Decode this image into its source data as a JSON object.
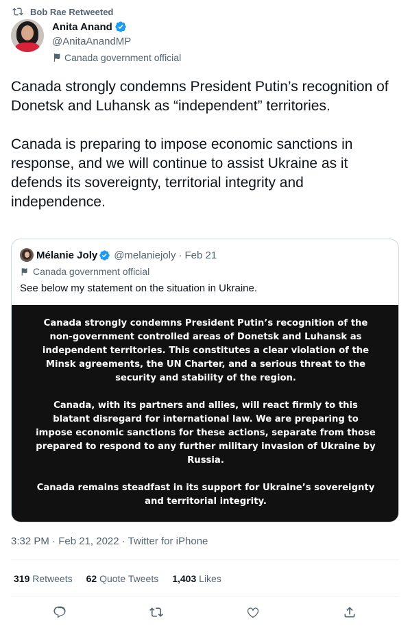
{
  "retweet": {
    "label": "Bob Rae Retweeted",
    "icon": "retweet-icon"
  },
  "author": {
    "name": "Anita Anand",
    "handle": "@AnitaAnandMP",
    "label": "Canada government official"
  },
  "tweet": {
    "text": "Canada strongly condemns President Putin’s recognition of Donetsk and Luhansk as “independent” territories.\n\nCanada is preparing to impose economic sanctions in response, and we will continue to assist Ukraine as it defends its sovereignty, territorial integrity and independence."
  },
  "quote": {
    "name": "Mélanie Joly",
    "handle": "@melaniejoly",
    "separator": "·",
    "date": "Feb 21",
    "label": "Canada government official",
    "text": "See below my statement on the situation in Ukraine.",
    "statement": {
      "p1": "Canada strongly condemns President Putin’s recognition of the non-government controlled areas of Donetsk and Luhansk as independent territories. This constitutes a clear violation of the Minsk agreements, the UN Charter, and a serious threat to the security and stability of the region.",
      "p2": "Canada, with its partners and allies, will react firmly to this blatant disregard for international law. We are preparing to impose economic sanctions for these actions, separate from those prepared to respond to any further military invasion of Ukraine by Russia.",
      "p3": "Canada remains steadfast in its support for Ukraine’s sovereignty and territorial integrity."
    }
  },
  "timestamp": "3:32 PM · Feb 21, 2022 · Twitter for iPhone",
  "stats": {
    "retweets_count": "319",
    "retweets_label": "Retweets",
    "quotes_count": "62",
    "quotes_label": "Quote Tweets",
    "likes_count": "1,403",
    "likes_label": "Likes"
  },
  "actions": [
    "reply-icon",
    "retweet-icon",
    "like-icon",
    "share-icon"
  ],
  "colors": {
    "verified": "#1d9bf0",
    "secondary_text": "#536471",
    "statement_bg": "#111111"
  }
}
